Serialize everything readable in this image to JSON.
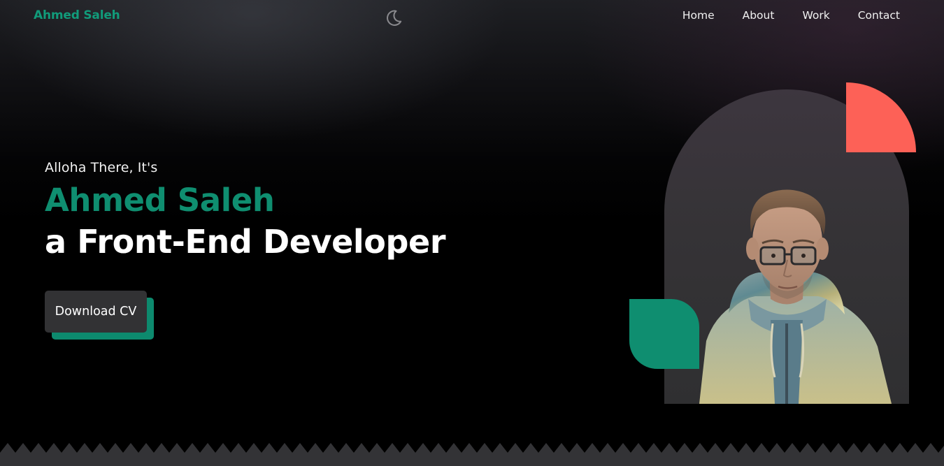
{
  "brand": {
    "name": "Ahmed Saleh",
    "color": "#119b7a"
  },
  "theme_toggle": {
    "icon": "moon-icon"
  },
  "nav": {
    "items": [
      {
        "label": "Home"
      },
      {
        "label": "About"
      },
      {
        "label": "Work"
      },
      {
        "label": "Contact"
      }
    ]
  },
  "hero": {
    "greeting": "Alloha There, It's",
    "name": "Ahmed Saleh",
    "role": "a Front-End Developer",
    "cta_label": "Download CV"
  },
  "colors": {
    "accent_green": "#0f8e70",
    "accent_coral": "#fd6157",
    "background": "#000000",
    "button_bg": "#323234",
    "footer_band": "#333336"
  }
}
